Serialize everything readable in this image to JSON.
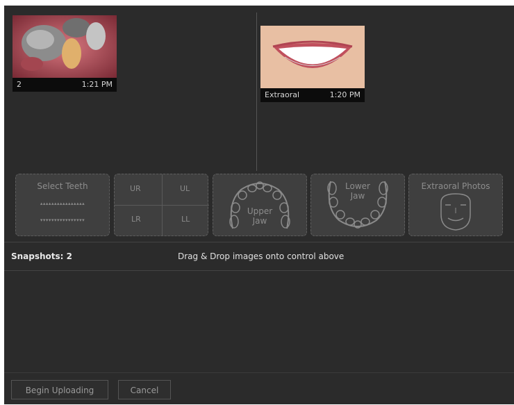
{
  "thumbnails": [
    {
      "label": "2",
      "time": "1:21 PM",
      "image": "intraoral-teeth-photo"
    },
    {
      "label": "Extraoral",
      "time": "1:20 PM",
      "image": "smile-photo"
    }
  ],
  "drop_zones": {
    "select_teeth": {
      "title": "Select Teeth",
      "upper_glyphs": "▴▴▴▴▴▴▴▴▴▴▴▴▴▴▴▴",
      "lower_glyphs": "▾▾▾▾▾▾▾▾▾▾▾▾▾▾▾▾"
    },
    "quadrants": {
      "ur": "UR",
      "ul": "UL",
      "lr": "LR",
      "ll": "LL"
    },
    "upper_jaw": {
      "line1": "Upper",
      "line2": "Jaw"
    },
    "lower_jaw": {
      "line1": "Lower",
      "line2": "Jaw"
    },
    "extraoral": {
      "title": "Extraoral Photos"
    }
  },
  "status": {
    "snapshots": "Snapshots: 2",
    "hint": "Drag & Drop images onto control above"
  },
  "buttons": {
    "begin_uploading": "Begin Uploading",
    "cancel": "Cancel"
  },
  "colors": {
    "background": "#2b2b2b",
    "zone_fill": "#3f3f3f",
    "zone_text": "#8d8d8d"
  }
}
